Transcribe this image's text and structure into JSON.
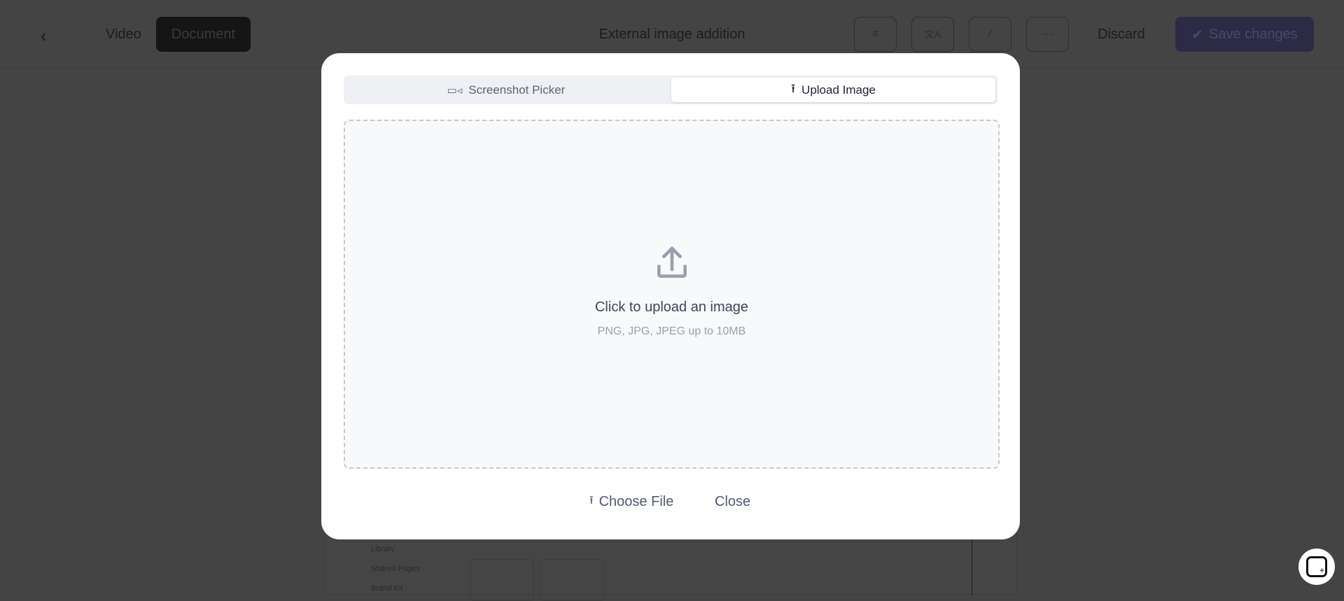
{
  "topbar": {
    "video_label": "Video",
    "document_label": "Document",
    "title": "External image addition",
    "discard_label": "Discard",
    "save_label": "Save changes"
  },
  "background": {
    "sidebar_items": [
      "Library",
      "Shared Pages",
      "Brand Kit"
    ]
  },
  "modal": {
    "tabs": [
      {
        "label": "Screenshot Picker",
        "icon": "video-icon",
        "active": false
      },
      {
        "label": "Upload Image",
        "icon": "upload-icon",
        "active": true
      }
    ],
    "dropzone": {
      "title": "Click to upload an image",
      "subtitle": "PNG, JPG, JPEG up to 10MB"
    },
    "choose_file_label": "Choose File",
    "close_label": "Close"
  },
  "colors": {
    "overlay": "#444444",
    "save_button": "#2c2a44",
    "modal": "#ffffff"
  }
}
